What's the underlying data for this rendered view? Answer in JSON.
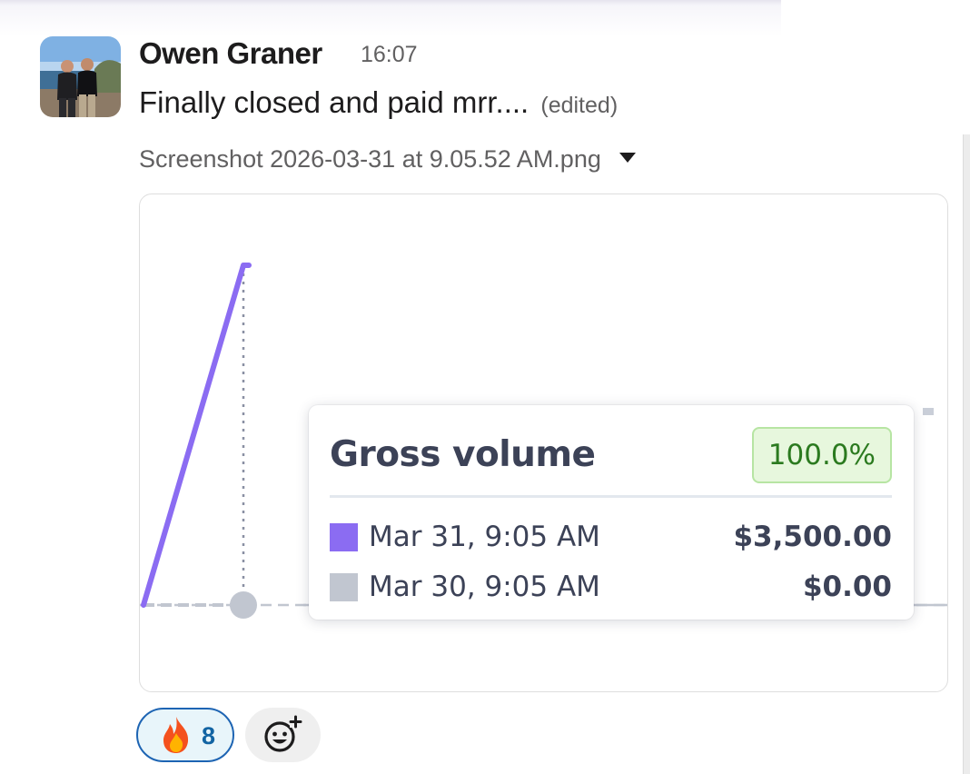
{
  "message": {
    "author": "Owen Graner",
    "time": "16:07",
    "text": "Finally closed and paid mrr....",
    "edited_label": "(edited)"
  },
  "attachment": {
    "filename": "Screenshot 2026-03-31 at 9.05.52 AM.png"
  },
  "chart_data": {
    "type": "line",
    "series": [
      {
        "name": "Mar 31, 9:05 AM",
        "color": "#8b6cf2",
        "x": [
          0,
          1
        ],
        "values": [
          0,
          3500
        ]
      },
      {
        "name": "Mar 30, 9:05 AM",
        "color": "#c1c6d0",
        "x": [
          0,
          1
        ],
        "values": [
          0,
          0
        ]
      }
    ],
    "tooltip": {
      "title": "Gross volume",
      "change": "100.0%",
      "rows": [
        {
          "label": "Mar 31, 9:05 AM",
          "value": "$3,500.00",
          "color": "#8b6cf2"
        },
        {
          "label": "Mar 30, 9:05 AM",
          "value": "$0.00",
          "color": "#c1c6d0"
        }
      ]
    }
  },
  "reactions": [
    {
      "emoji": "fire",
      "count": "8",
      "active": true
    }
  ],
  "icons": {
    "reaction_emoji": "fire-icon",
    "add_reaction": "add-reaction-icon",
    "dropdown": "caret-down-icon"
  }
}
